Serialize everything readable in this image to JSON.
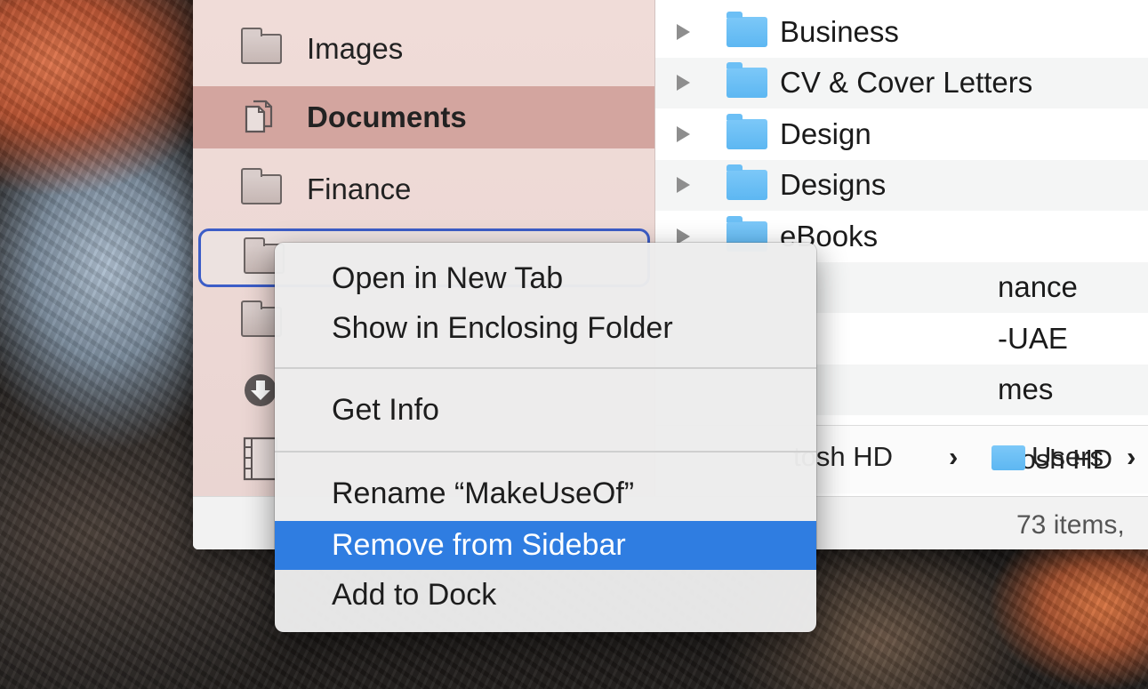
{
  "sidebar": {
    "items": [
      {
        "label": "Images",
        "icon": "folder-icon"
      },
      {
        "label": "Documents",
        "icon": "documents-icon",
        "selected": true
      },
      {
        "label": "Finance",
        "icon": "folder-icon"
      },
      {
        "label": "",
        "icon": "folder-icon",
        "renaming": true
      },
      {
        "label": "",
        "icon": "folder-icon"
      },
      {
        "label": "",
        "icon": "downloads-icon"
      },
      {
        "label": "",
        "icon": "movies-icon"
      }
    ]
  },
  "file_list": {
    "rows": [
      {
        "name": "Business"
      },
      {
        "name": "CV & Cover Letters"
      },
      {
        "name": "Design"
      },
      {
        "name": "Designs"
      },
      {
        "name": "eBooks"
      },
      {
        "name": "nance"
      },
      {
        "name": "-UAE"
      },
      {
        "name": "mes"
      }
    ]
  },
  "path_bar": {
    "disk": "tosh HD",
    "separator": "›",
    "users": "Users"
  },
  "status": {
    "item_count": "73 items,"
  },
  "context_menu": {
    "open_new_tab": "Open in New Tab",
    "show_enclosing": "Show in Enclosing Folder",
    "get_info": "Get Info",
    "rename": "Rename “MakeUseOf”",
    "remove_sidebar": "Remove from Sidebar",
    "add_dock": "Add to Dock"
  },
  "colors": {
    "selection_blue": "#2f7de1",
    "sidebar_selected": "#d3a59f",
    "folder_blue": "#5db7f2"
  }
}
